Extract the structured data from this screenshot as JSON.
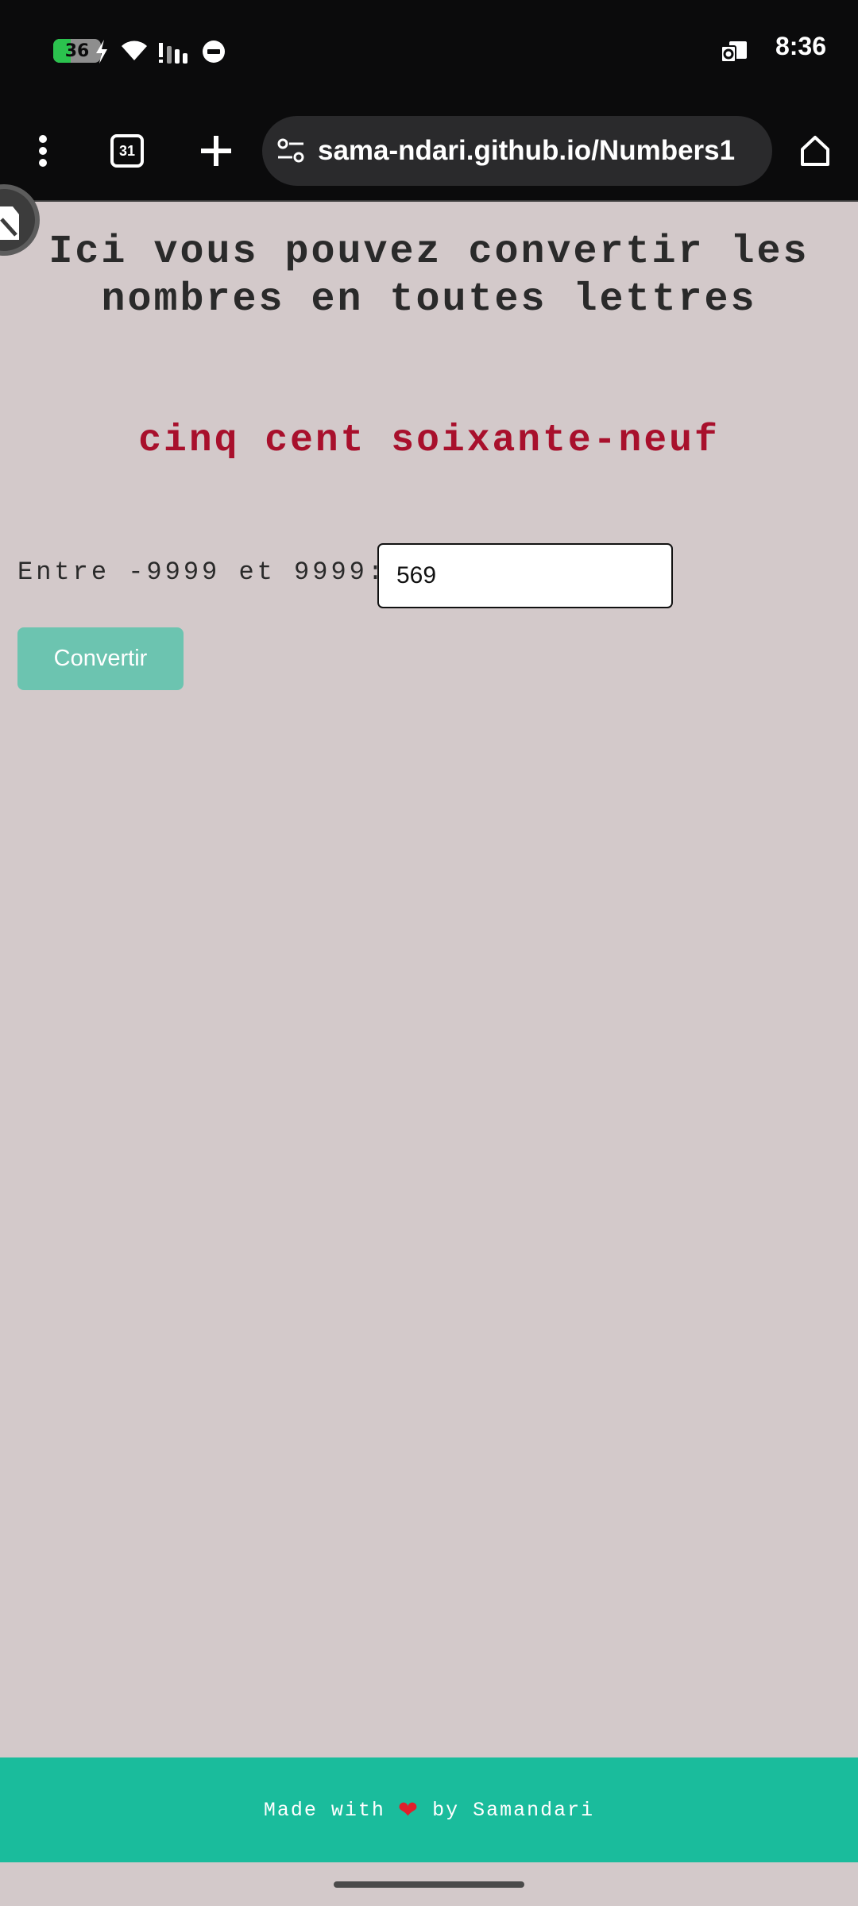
{
  "status_bar": {
    "battery_level": "36",
    "battery_percent": 36,
    "time": "8:36",
    "icons": [
      "battery-charging-icon",
      "wifi-icon",
      "signal-icon",
      "do-not-disturb-icon",
      "outlook-notification-icon"
    ]
  },
  "browser": {
    "url": "sama-ndari.github.io/Numbers1",
    "tab_count": "31",
    "icons": [
      "menu-dots-icon",
      "tabs-icon",
      "new-tab-plus-icon",
      "site-settings-icon",
      "home-icon"
    ]
  },
  "page": {
    "title": "Ici vous pouvez convertir les nombres en toutes lettres",
    "result": "cinq cent soixante-neuf",
    "range_label": "Entre -9999 et 9999:",
    "input_value": "569",
    "convert_label": "Convertir"
  },
  "footer": {
    "made_with": "Made with",
    "heart": "❤",
    "by": "by Samandari"
  },
  "colors": {
    "page_background": "#d3c9ca",
    "result_text": "#a8102c",
    "button": "#6cc4b0",
    "footer": "#1abc9c",
    "status_bar": "#0b0b0c"
  }
}
